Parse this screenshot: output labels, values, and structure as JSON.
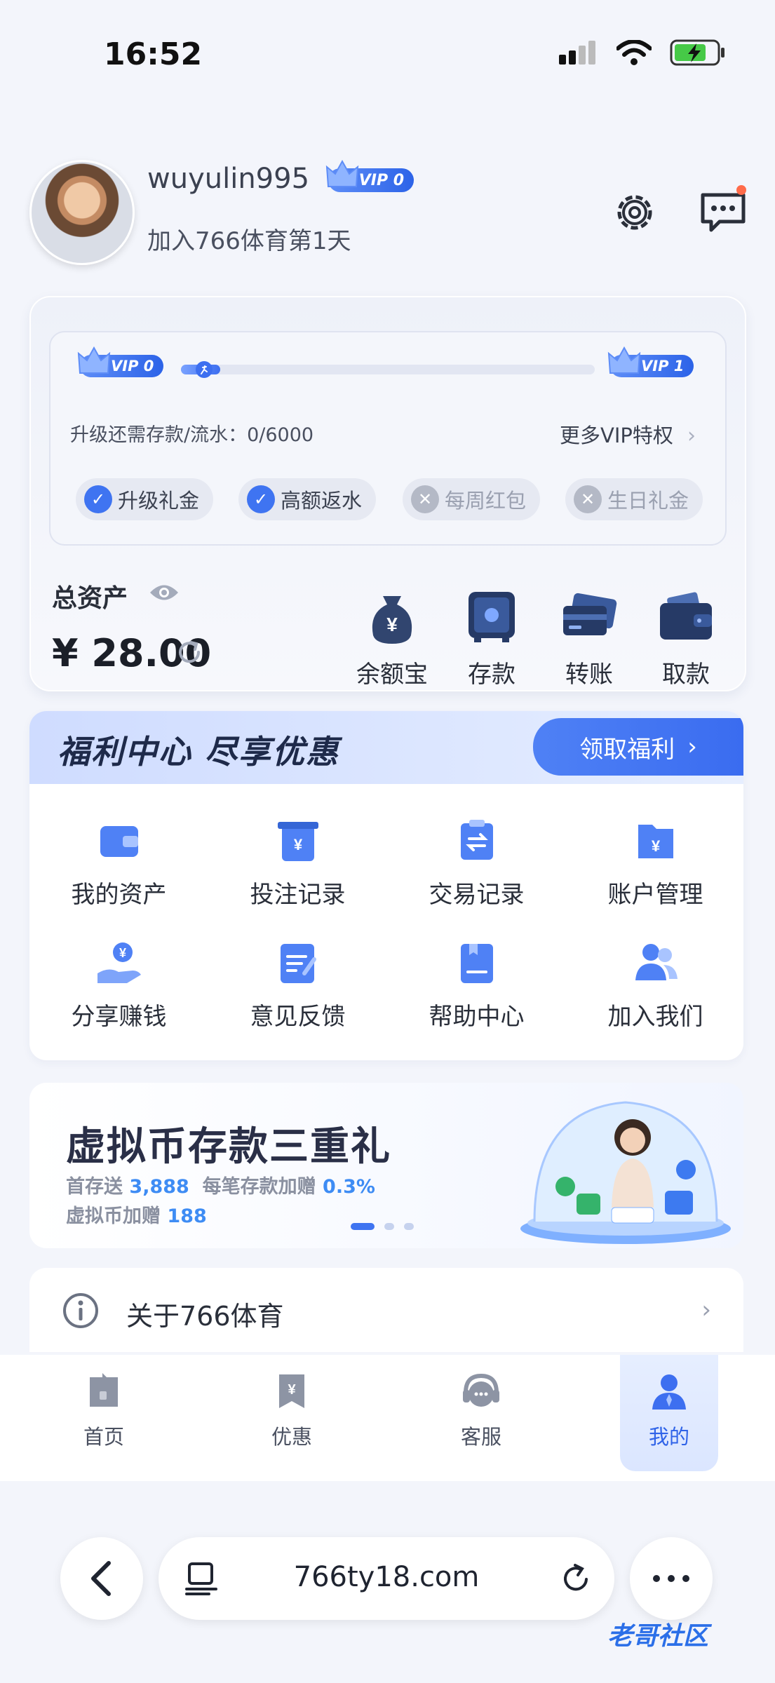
{
  "status": {
    "time": "16:52"
  },
  "profile": {
    "username": "wuyulin995",
    "vip_level": "VIP 0",
    "join_text": "加入766体育第1天"
  },
  "vip_panel": {
    "current": "VIP 0",
    "next": "VIP 1",
    "progress": 0.0,
    "upgrade_text": "升级还需存款/流水：0/6000",
    "more_label": "更多VIP特权",
    "privileges": [
      {
        "label": "升级礼金",
        "enabled": true
      },
      {
        "label": "高额返水",
        "enabled": true
      },
      {
        "label": "每周红包",
        "enabled": false
      },
      {
        "label": "生日礼金",
        "enabled": false
      }
    ]
  },
  "assets": {
    "total_label": "总资产",
    "amount": "¥ 28.00",
    "actions": [
      {
        "label": "余额宝",
        "icon": "money-bag-icon"
      },
      {
        "label": "存款",
        "icon": "safe-icon"
      },
      {
        "label": "转账",
        "icon": "cards-icon"
      },
      {
        "label": "取款",
        "icon": "wallet-icon"
      }
    ]
  },
  "welfare": {
    "title": "福利中心 尽享优惠",
    "button": "领取福利",
    "items": [
      {
        "label": "我的资产",
        "icon": "wallet-icon"
      },
      {
        "label": "投注记录",
        "icon": "bet-record-icon"
      },
      {
        "label": "交易记录",
        "icon": "transaction-icon"
      },
      {
        "label": "账户管理",
        "icon": "account-icon"
      },
      {
        "label": "分享赚钱",
        "icon": "share-money-icon"
      },
      {
        "label": "意见反馈",
        "icon": "feedback-icon"
      },
      {
        "label": "帮助中心",
        "icon": "help-book-icon"
      },
      {
        "label": "加入我们",
        "icon": "users-icon"
      }
    ]
  },
  "banner": {
    "title": "虚拟币存款三重礼",
    "line1_a": "首存送",
    "line1_b": "3,888",
    "line1_c": "每笔存款加赠",
    "line1_d": "0.3%",
    "line2_a": "虚拟币加赠",
    "line2_b": "188"
  },
  "about": {
    "label": "关于766体育"
  },
  "tabbar": {
    "items": [
      {
        "label": "首页",
        "icon": "home-icon",
        "active": false
      },
      {
        "label": "优惠",
        "icon": "coupon-icon",
        "active": false
      },
      {
        "label": "客服",
        "icon": "headset-icon",
        "active": false
      },
      {
        "label": "我的",
        "icon": "profile-icon",
        "active": true
      }
    ]
  },
  "browser": {
    "url": "766ty18.com"
  },
  "watermark": "老哥社区"
}
